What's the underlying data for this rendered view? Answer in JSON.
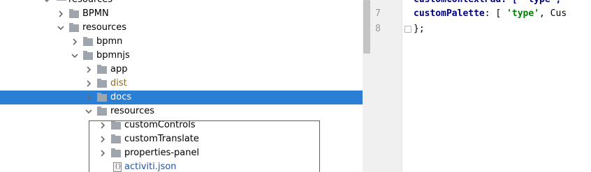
{
  "tree": {
    "rows": [
      {
        "label": "resources",
        "indent": 0,
        "expanded": true,
        "icon": "module-folder-icon"
      },
      {
        "label": "BPMN",
        "indent": 1,
        "expanded": false,
        "icon": "folder-icon"
      },
      {
        "label": "resources",
        "indent": 1,
        "expanded": true,
        "icon": "folder-icon"
      },
      {
        "label": "bpmn",
        "indent": 2,
        "expanded": false,
        "icon": "folder-icon"
      },
      {
        "label": "bpmnjs",
        "indent": 2,
        "expanded": true,
        "icon": "folder-icon"
      },
      {
        "label": "app",
        "indent": 3,
        "expanded": false,
        "icon": "folder-icon"
      },
      {
        "label": "dist",
        "indent": 3,
        "expanded": false,
        "icon": "folder-icon",
        "muted": true
      },
      {
        "label": "docs",
        "indent": 3,
        "expanded": false,
        "icon": "folder-icon",
        "selected": true
      },
      {
        "label": "resources",
        "indent": 3,
        "expanded": true,
        "icon": "folder-icon"
      },
      {
        "label": "customControls",
        "indent": 4,
        "expanded": false,
        "icon": "folder-icon"
      },
      {
        "label": "customTranslate",
        "indent": 4,
        "expanded": false,
        "icon": "folder-icon"
      },
      {
        "label": "properties-panel",
        "indent": 4,
        "expanded": false,
        "icon": "folder-icon"
      },
      {
        "label": "activiti.json",
        "indent": 4,
        "icon": "json-file-icon",
        "file": true
      }
    ],
    "colors": {
      "selection": "#2a7fd4",
      "highlight_box": "#d42b2b"
    }
  },
  "editor": {
    "lines": [
      {
        "number": "",
        "segments": [
          {
            "t": "customContextPad: [ 'type', ",
            "c": "kw"
          }
        ]
      },
      {
        "number": "7",
        "segments": [
          {
            "t": "customPalette",
            "c": "kw"
          },
          {
            "t": ": [ ",
            "c": "plain"
          },
          {
            "t": "'type'",
            "c": "str"
          },
          {
            "t": ", Cus",
            "c": "plain"
          }
        ]
      },
      {
        "number": "8",
        "segments": [
          {
            "t": "};",
            "c": "plain"
          }
        ]
      }
    ]
  }
}
